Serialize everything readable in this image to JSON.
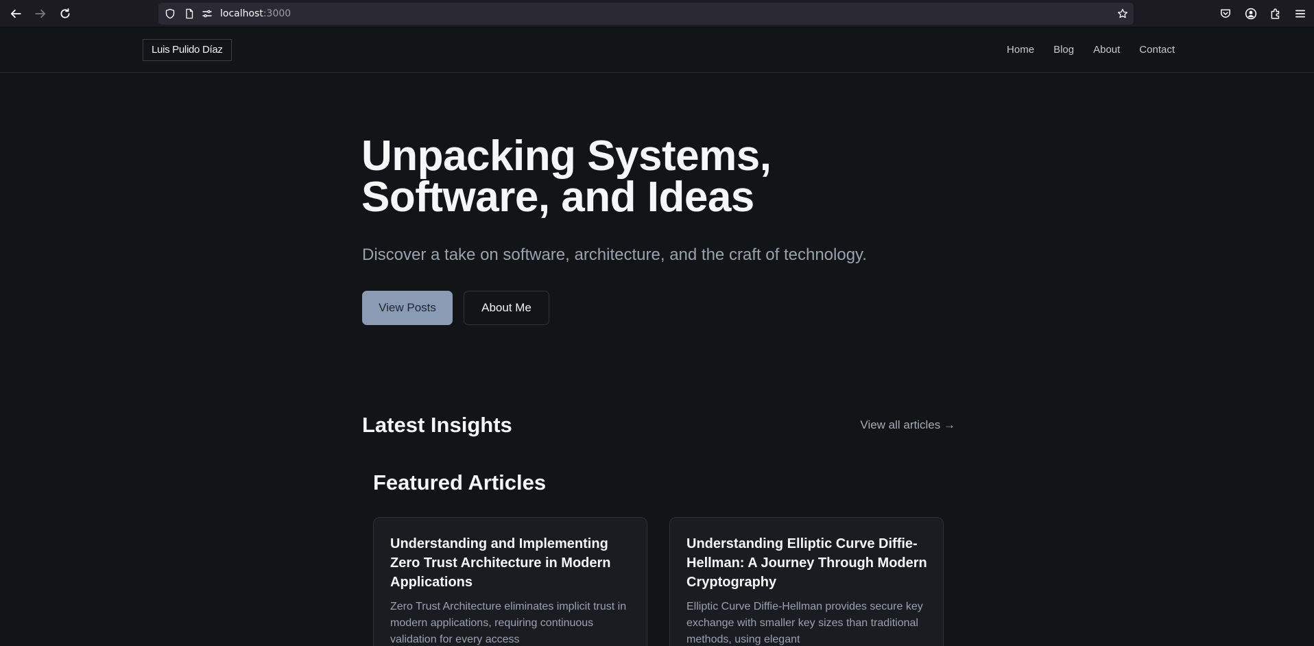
{
  "browser": {
    "url_host": "localhost",
    "url_port": ":3000"
  },
  "header": {
    "brand": "Luis Pulido Díaz",
    "nav": [
      "Home",
      "Blog",
      "About",
      "Contact"
    ]
  },
  "hero": {
    "title": "Unpacking Systems, Software, and Ideas",
    "subtitle": "Discover a take on software, architecture, and the craft of technology.",
    "primary_button": "View Posts",
    "secondary_button": "About Me"
  },
  "insights": {
    "title": "Latest Insights",
    "view_all": "View all articles →",
    "featured_title": "Featured Articles",
    "articles": [
      {
        "title": "Understanding and Implementing Zero Trust Architecture in Modern Applications",
        "excerpt": "Zero Trust Architecture eliminates implicit trust in modern applications, requiring continuous validation for every access"
      },
      {
        "title": "Understanding Elliptic Curve Diffie-Hellman: A Journey Through Modern Cryptography",
        "excerpt": "Elliptic Curve Diffie-Hellman provides secure key exchange with smaller key sizes than traditional methods, using elegant"
      }
    ]
  },
  "icons": {
    "back": "back-arrow-icon",
    "forward": "forward-arrow-icon",
    "reload": "reload-icon",
    "shield": "shield-icon",
    "page": "page-icon",
    "permissions": "permissions-icon",
    "bookmark": "star-icon",
    "pocket": "pocket-icon",
    "account": "account-icon",
    "extensions": "extensions-icon",
    "menu": "hamburger-menu-icon"
  },
  "colors": {
    "background": "#121517",
    "primary_button": "#8a9bb3",
    "card": "#1a1c21"
  }
}
